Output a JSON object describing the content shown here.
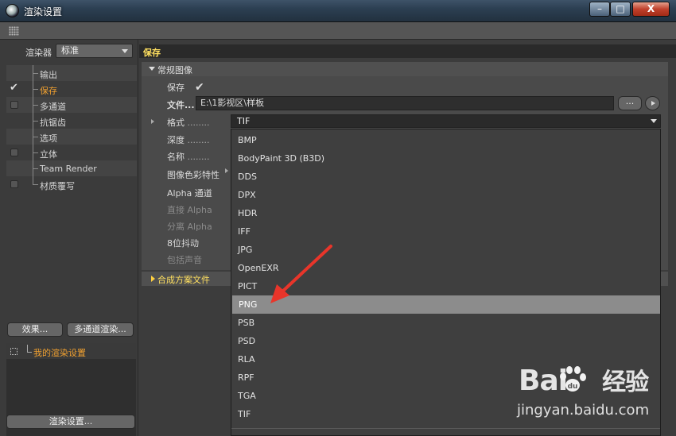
{
  "window": {
    "title": "渲染设置",
    "minimize": "–",
    "maximize": "□",
    "close": "X"
  },
  "left": {
    "renderer_label": "渲染器",
    "renderer_value": "标准",
    "tree": [
      {
        "label": "输出",
        "checkbox": "none",
        "selected": false
      },
      {
        "label": "保存",
        "checkbox": "checked",
        "selected": true
      },
      {
        "label": "多通道",
        "checkbox": "box",
        "selected": false
      },
      {
        "label": "抗锯齿",
        "checkbox": "none",
        "selected": false
      },
      {
        "label": "选项",
        "checkbox": "none",
        "selected": false
      },
      {
        "label": "立体",
        "checkbox": "box",
        "selected": false
      },
      {
        "label": "Team Render",
        "checkbox": "none",
        "selected": false
      },
      {
        "label": "材质覆写",
        "checkbox": "box",
        "selected": false
      }
    ],
    "effects_button": "效果...",
    "multipass_button": "多通道渲染...",
    "preset_label": "我的渲染设置",
    "render_settings_button": "渲染设置..."
  },
  "right": {
    "save_header": "保存",
    "group_regular": "常规图像",
    "save_label": "保存",
    "save_check": "✔",
    "file_label": "文件...",
    "file_value": "E:\\1影视区\\样板",
    "browse_label": "...",
    "format_label": "格式",
    "format_value": "TIF",
    "depth_label": "深度",
    "name_label": "名称",
    "color_label": "图像色彩特性",
    "alpha_label": "Alpha 通道",
    "straight_alpha_label": "直接 Alpha",
    "separate_alpha_label": "分离 Alpha",
    "dither_label": "8位抖动",
    "sound_label": "包括声音",
    "group_compositing": "合成方案文件",
    "dots": "........"
  },
  "dropdown": {
    "items": [
      "BMP",
      "BodyPaint 3D (B3D)",
      "DDS",
      "DPX",
      "HDR",
      "IFF",
      "JPG",
      "OpenEXR",
      "PICT",
      "PNG",
      "PSB",
      "PSD",
      "RLA",
      "RPF",
      "TGA",
      "TIF"
    ],
    "highlighted": "PNG"
  },
  "colors": {
    "accent": "#f0a030",
    "header_text": "#ffe060",
    "annotation": "#e8352a"
  },
  "watermark": {
    "brand": "Bai",
    "brand_cn": "经验",
    "url": "jingyan.baidu.com"
  }
}
